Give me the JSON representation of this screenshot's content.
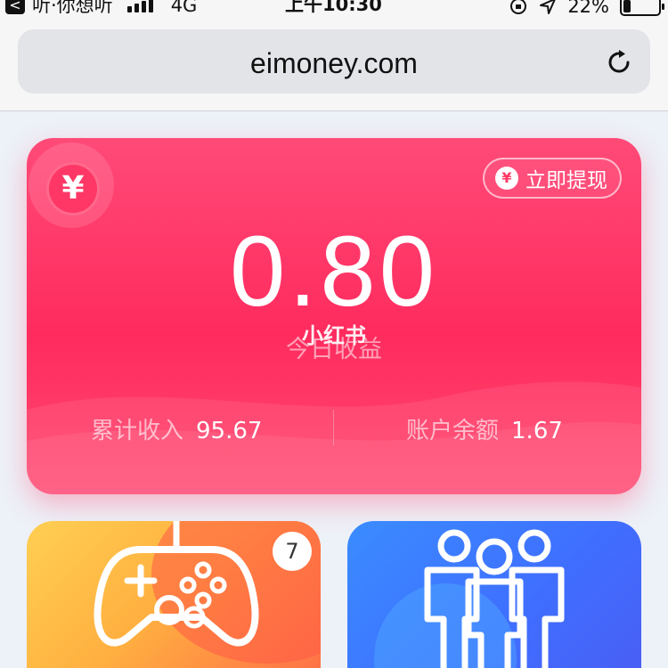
{
  "status_bar": {
    "back_glyph": "<",
    "carrier": "听·你想听",
    "network": "4G",
    "time": "上午10:30",
    "battery": "22%",
    "battery_level": 0.22
  },
  "browser": {
    "url": "eimoney.com"
  },
  "earnings": {
    "coin_glyph": "¥",
    "withdraw_label": "立即提现",
    "today_amount": "0.80",
    "today_label": "今日收益",
    "watermark": "小红书",
    "total_label": "累计收入",
    "total_value": "95.67",
    "balance_label": "账户余额",
    "balance_value": "1.67"
  },
  "tiles": {
    "game_badge": "7"
  },
  "colors": {
    "card_accent": "#ff2b5e",
    "game_tile": "#ffb040",
    "friends_tile": "#3f6fff"
  },
  "icons": [
    "back-icon",
    "signal-icon",
    "orientation-lock-icon",
    "location-icon",
    "battery-icon",
    "reload-icon",
    "yuan-coin-icon",
    "gamepad-icon",
    "group-icon"
  ]
}
